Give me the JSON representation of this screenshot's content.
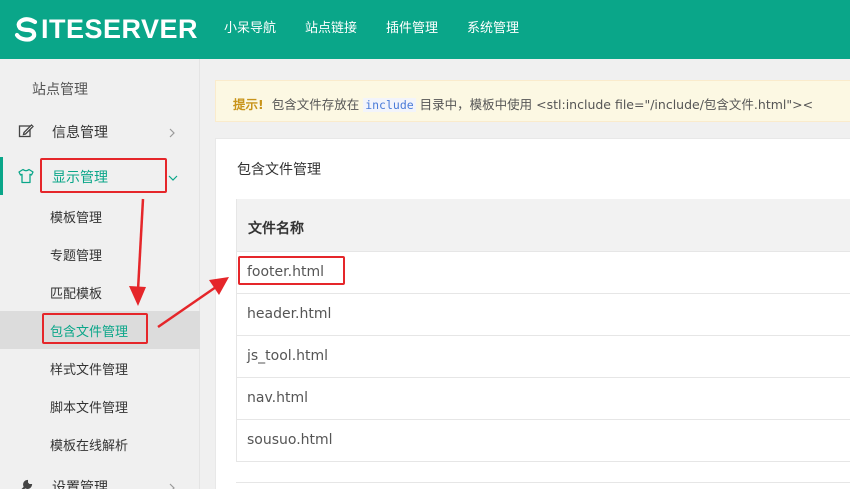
{
  "app": {
    "logo_text": "ITESERVER",
    "nav": [
      "小呆导航",
      "站点链接",
      "插件管理",
      "系统管理"
    ],
    "brand_color": "#0aa689"
  },
  "sidebar": {
    "section_title": "站点管理",
    "menu": [
      {
        "label": "信息管理",
        "icon": "edit-icon",
        "arrow": "chevron-right"
      },
      {
        "label": "显示管理",
        "icon": "tshirt-icon",
        "arrow": "chevron-down",
        "active": true
      },
      {
        "label": "设置管理",
        "icon": "wrench-icon",
        "arrow": "chevron-right"
      }
    ],
    "submenu": [
      "模板管理",
      "专题管理",
      "匹配模板",
      "包含文件管理",
      "样式文件管理",
      "脚本文件管理",
      "模板在线解析"
    ],
    "selected_submenu": "包含文件管理"
  },
  "alert": {
    "label": "提示!",
    "text_before": "包含文件存放在",
    "code": "include",
    "text_after": "目录中，模板中使用 <stl:include file=\"/include/包含文件.html\"><"
  },
  "card": {
    "title": "包含文件管理",
    "table": {
      "header": "文件名称",
      "rows": [
        "footer.html",
        "header.html",
        "js_tool.html",
        "nav.html",
        "sousuo.html"
      ]
    }
  },
  "annotation_color": "#e5262a"
}
